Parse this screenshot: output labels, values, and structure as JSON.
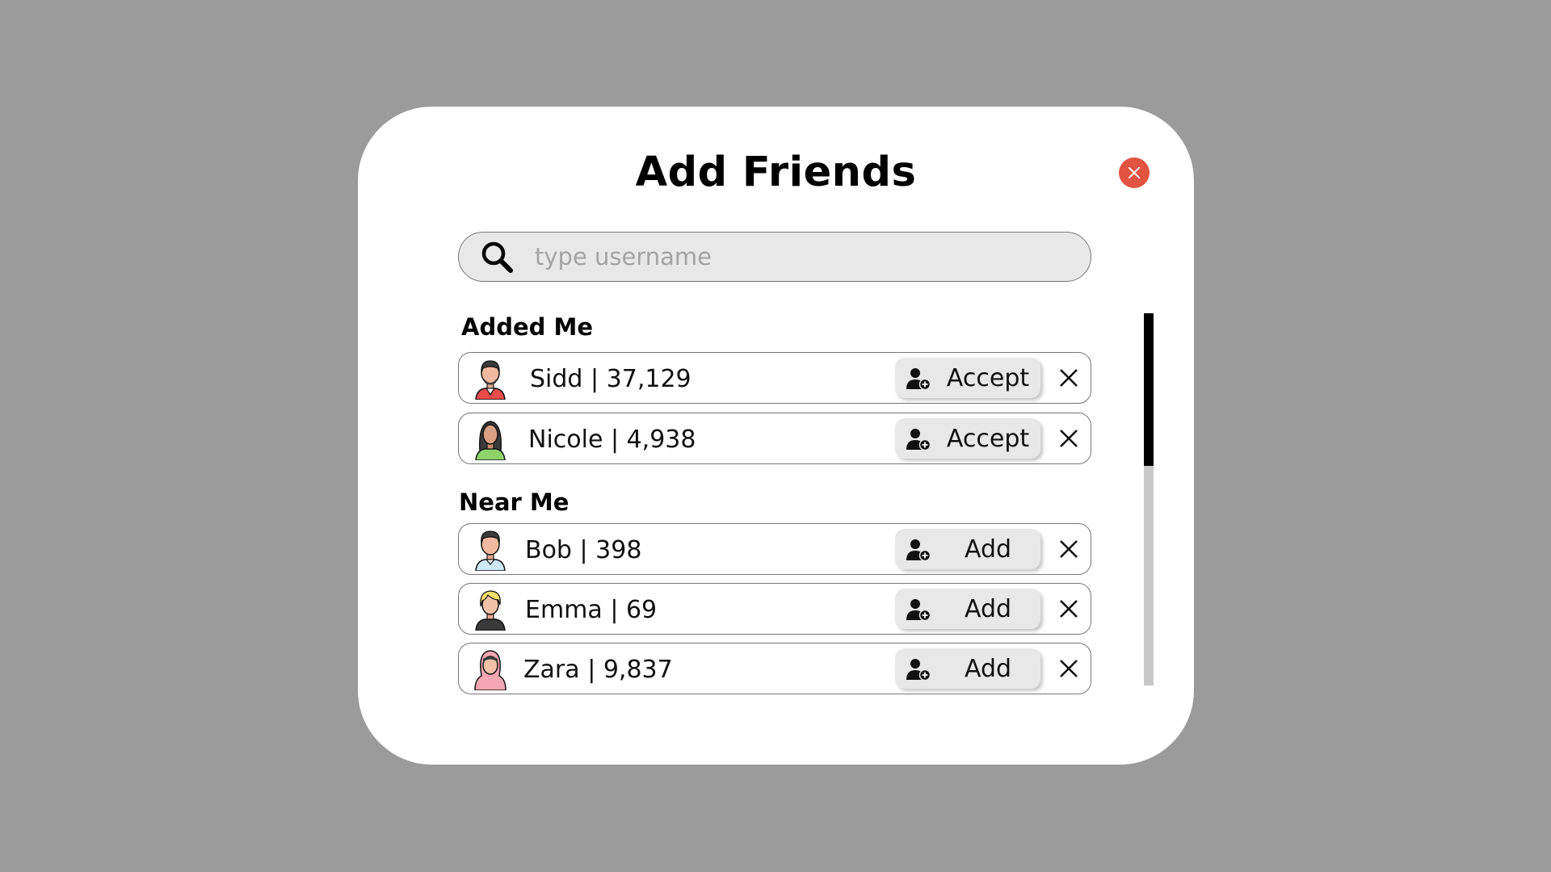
{
  "modal": {
    "title": "Add Friends",
    "close_icon": "close-icon"
  },
  "search": {
    "placeholder": "type username",
    "value": "",
    "icon": "search-icon"
  },
  "sections": {
    "added_me": {
      "title": "Added Me",
      "items": [
        {
          "name": "Sidd",
          "score": "37,129",
          "label": "Sidd | 37,129",
          "action": "Accept",
          "avatar": "man-red-shirt-avatar"
        },
        {
          "name": "Nicole",
          "score": "4,938",
          "label": "Nicole | 4,938",
          "action": "Accept",
          "avatar": "woman-green-shirt-avatar"
        }
      ]
    },
    "near_me": {
      "title": "Near Me",
      "items": [
        {
          "name": "Bob",
          "score": "398",
          "label": "Bob | 398",
          "action": "Add",
          "avatar": "man-blue-shirt-avatar"
        },
        {
          "name": "Emma",
          "score": "69",
          "label": "Emma | 69",
          "action": "Add",
          "avatar": "blonde-woman-avatar"
        },
        {
          "name": "Zara",
          "score": "9,837",
          "label": "Zara | 9,837",
          "action": "Add",
          "avatar": "hijab-woman-avatar"
        }
      ]
    }
  },
  "icons": {
    "action": "add-user-icon",
    "dismiss": "close-x-icon"
  },
  "colors": {
    "backdrop": "#9b9b9b",
    "modal": "#ffffff",
    "close_button": "#e25441",
    "field": "#e8e8e8",
    "scroll_thumb": "#000000",
    "scroll_track": "#c8c8c8"
  },
  "scroll": {
    "visible_fraction": 0.41
  }
}
